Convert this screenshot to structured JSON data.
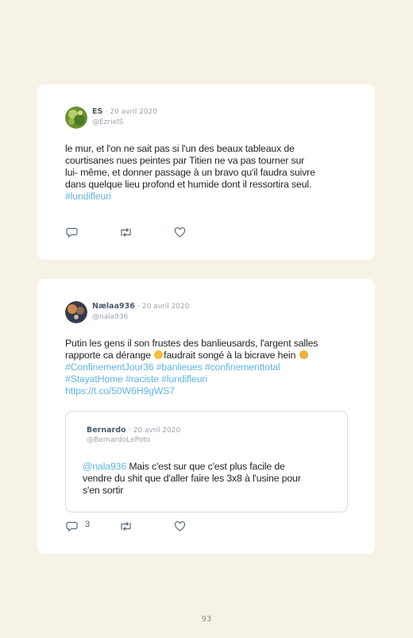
{
  "page_number": "93",
  "tweets": [
    {
      "name": "ES",
      "date": "· 20 avril 2020",
      "handle": "@EzrielS",
      "lines": [
        "le mur, et l'on ne sait pas si l'un des beaux tableaux de",
        "courtisanes nues peintes par Titien ne va pas tourner sur",
        "lui- même, et donner passage à un bravo qu'il faudra suivre",
        "dans quelque lieu profond et humide dont il ressortira seul."
      ],
      "hashtag_line": "#lundifleuri"
    },
    {
      "name": "Nælaa936",
      "date": "· 20 avril 2020",
      "handle": "@nala936",
      "line1": "Putin les gens il son frustes des banlieusards, l'argent salles",
      "line2_before_emoji": "rapporte ca dérange ",
      "line2_middle": "faudrait songé à la bicrave hein ",
      "hashtags_line3": "#ConfinementJour36 #banlieues #confinementtotal",
      "hashtags_line4": "#StayatHome #raciste #lundifleuri",
      "url": "https://t.co/50W6H9gWS7",
      "reply_count": "3",
      "quote": {
        "name": "Bernardo",
        "date": "· 20 avril 2020",
        "handle": "@BernardoLePoto",
        "mention": "@nala936",
        "line1_rest": " Mais c'est sur que c'est plus facile de",
        "line2": "vendre du shit que d'aller faire les 3x8 à l'usine pour",
        "line3": "s'en sortir"
      }
    }
  ],
  "colors": {
    "background": "#f6f2e6",
    "card": "#ffffff",
    "link": "#5fb6e4",
    "name": "#4c5a6c",
    "meta": "#9aa3ad"
  },
  "icons": [
    "reply-icon",
    "retweet-icon",
    "like-icon"
  ]
}
